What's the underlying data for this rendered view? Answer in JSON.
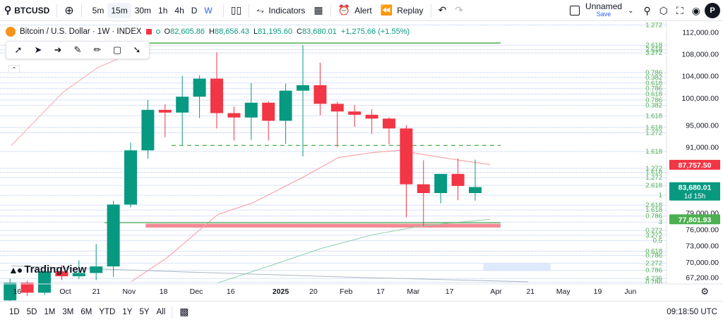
{
  "toolbar": {
    "symbol": "BTCUSD",
    "intervals": [
      "5m",
      "15m",
      "30m",
      "1h",
      "4h",
      "D",
      "W"
    ],
    "active_interval": "15m",
    "indicators_label": "Indicators",
    "alert_label": "Alert",
    "replay_label": "Replay",
    "layout_name": "Unnamed",
    "save_label": "Save",
    "profile_initial": "P"
  },
  "legend": {
    "title": "Bitcoin / U.S. Dollar · 1W · INDEX",
    "o_label": "O",
    "o_value": "82,605.86",
    "h_label": "H",
    "h_value": "88,656.43",
    "l_label": "L",
    "l_value": "81,195.60",
    "c_label": "C",
    "c_value": "83,680.01",
    "change": "+1,275.66 (+1.55%)"
  },
  "watermark": {
    "brand": "TradingView"
  },
  "bottom": {
    "ranges": [
      "1D",
      "5D",
      "1M",
      "3M",
      "6M",
      "YTD",
      "1Y",
      "5Y",
      "All"
    ],
    "clock": "09:18:50 UTC"
  },
  "colors": {
    "up": "#089981",
    "down": "#f23645",
    "grid": "#b2c5ef",
    "fib": "#4caf50",
    "ma_red": "#f7a6ad",
    "ma_green": "#8ccfa8"
  },
  "chart_data": {
    "type": "candlestick",
    "title": "",
    "ylim": [
      66000,
      114000
    ],
    "xlim_weeks": [
      0,
      52
    ],
    "price_ticks": [
      "112,000.00",
      "108,000.00",
      "104,000.00",
      "100,000.00",
      "95,000.00",
      "91,000.00",
      "79,000.00",
      "76,000.00",
      "73,000.00",
      "70,000.00",
      "67,200.00"
    ],
    "price_tick_values": [
      112000,
      108000,
      104000,
      100000,
      95000,
      91000,
      79000,
      76000,
      73000,
      70000,
      67200
    ],
    "time_labels": [
      {
        "label": "16",
        "w": 0.5
      },
      {
        "label": "Oct",
        "w": 3.3
      },
      {
        "label": "21",
        "w": 5.1
      },
      {
        "label": "Nov",
        "w": 7.0
      },
      {
        "label": "18",
        "w": 9.0
      },
      {
        "label": "Dec",
        "w": 10.9
      },
      {
        "label": "16",
        "w": 12.9
      },
      {
        "label": "2025",
        "w": 15.8
      },
      {
        "label": "20",
        "w": 17.7
      },
      {
        "label": "Feb",
        "w": 19.6
      },
      {
        "label": "17",
        "w": 21.6
      },
      {
        "label": "Mar",
        "w": 23.5
      },
      {
        "label": "17",
        "w": 25.6
      },
      {
        "label": "Apr",
        "w": 28.3
      },
      {
        "label": "21",
        "w": 30.3
      },
      {
        "label": "May",
        "w": 32.2
      },
      {
        "label": "19",
        "w": 34.2
      },
      {
        "label": "Jun",
        "w": 36.1
      }
    ],
    "candles": [
      {
        "o": 63000,
        "h": 67000,
        "l": 62000,
        "c": 66200
      },
      {
        "o": 66200,
        "h": 66600,
        "l": 63800,
        "c": 64400
      },
      {
        "o": 64400,
        "h": 68600,
        "l": 64000,
        "c": 68300
      },
      {
        "o": 68300,
        "h": 69400,
        "l": 66700,
        "c": 67400
      },
      {
        "o": 67400,
        "h": 70300,
        "l": 66900,
        "c": 68000
      },
      {
        "o": 68000,
        "h": 73300,
        "l": 66700,
        "c": 69200
      },
      {
        "o": 69200,
        "h": 81200,
        "l": 67300,
        "c": 80500
      },
      {
        "o": 80500,
        "h": 91800,
        "l": 80000,
        "c": 90400
      },
      {
        "o": 90400,
        "h": 99600,
        "l": 88900,
        "c": 97800
      },
      {
        "o": 97800,
        "h": 98800,
        "l": 92800,
        "c": 97300
      },
      {
        "o": 97300,
        "h": 104000,
        "l": 91400,
        "c": 100200
      },
      {
        "o": 100200,
        "h": 104100,
        "l": 96300,
        "c": 103500
      },
      {
        "o": 103500,
        "h": 108300,
        "l": 94400,
        "c": 97200
      },
      {
        "o": 97200,
        "h": 98400,
        "l": 92200,
        "c": 96400
      },
      {
        "o": 96400,
        "h": 102700,
        "l": 92300,
        "c": 99100
      },
      {
        "o": 99100,
        "h": 99400,
        "l": 92200,
        "c": 95800
      },
      {
        "o": 95800,
        "h": 102600,
        "l": 91600,
        "c": 101300
      },
      {
        "o": 101300,
        "h": 109600,
        "l": 89300,
        "c": 102300
      },
      {
        "o": 102300,
        "h": 106400,
        "l": 96800,
        "c": 98900
      },
      {
        "o": 98900,
        "h": 99300,
        "l": 91000,
        "c": 97500
      },
      {
        "o": 97500,
        "h": 98700,
        "l": 94700,
        "c": 96900
      },
      {
        "o": 96900,
        "h": 97900,
        "l": 93400,
        "c": 96200
      },
      {
        "o": 96200,
        "h": 96400,
        "l": 91500,
        "c": 94400
      },
      {
        "o": 94400,
        "h": 95000,
        "l": 78200,
        "c": 84200
      },
      {
        "o": 84200,
        "h": 88600,
        "l": 76600,
        "c": 82600
      },
      {
        "o": 82600,
        "h": 85900,
        "l": 80700,
        "c": 86100
      },
      {
        "o": 86100,
        "h": 88900,
        "l": 81300,
        "c": 83900
      },
      {
        "o": 82600,
        "h": 88700,
        "l": 81200,
        "c": 83700
      }
    ],
    "fib_levels": [
      {
        "label": "1.272",
        "price": 113300
      },
      {
        "label": "2.618",
        "price": 109600
      },
      {
        "label": "2.618",
        "price": 108800
      },
      {
        "label": "3.272",
        "price": 108200
      },
      {
        "label": "0.786",
        "price": 104600
      },
      {
        "label": "0.382",
        "price": 103700
      },
      {
        "label": "0.618",
        "price": 102700
      },
      {
        "label": "0.786",
        "price": 101700
      },
      {
        "label": "0.618",
        "price": 100700
      },
      {
        "label": "0.786",
        "price": 99600
      },
      {
        "label": "0.382",
        "price": 98600
      },
      {
        "label": "1.618",
        "price": 96700
      },
      {
        "label": "1.618",
        "price": 94600
      },
      {
        "label": "1.272",
        "price": 93600
      },
      {
        "label": "1.618",
        "price": 90200
      },
      {
        "label": "1.272",
        "price": 87100
      },
      {
        "label": "1.618",
        "price": 86400
      },
      {
        "label": "1.272",
        "price": 85400
      },
      {
        "label": "2.618",
        "price": 84000
      },
      {
        "label": "1",
        "price": 82200
      },
      {
        "label": "2.618",
        "price": 80400
      },
      {
        "label": "1.618",
        "price": 79500
      },
      {
        "label": "0.786",
        "price": 78400
      },
      {
        "label": "3",
        "price": 77300
      },
      {
        "label": "0.272",
        "price": 75800
      },
      {
        "label": "3.272",
        "price": 74900
      },
      {
        "label": "0.5",
        "price": 73900
      },
      {
        "label": "0.618",
        "price": 72000
      },
      {
        "label": "0.786",
        "price": 71200
      },
      {
        "label": "2.272",
        "price": 69800
      },
      {
        "label": "0.786",
        "price": 68500
      },
      {
        "label": "4.236",
        "price": 67000
      },
      {
        "label": "0.786",
        "price": 66300
      }
    ],
    "price_badges": [
      {
        "label": "87,757.50",
        "price": 87757.5,
        "color": "#f23645"
      },
      {
        "label": "83,680.01",
        "sublabel": "1d 15h",
        "price": 83680.01,
        "color": "#089981"
      },
      {
        "label": "77,801.93",
        "price": 77801.93,
        "color": "#4caf50"
      }
    ],
    "resistance_line": {
      "price": 110000,
      "from_w": 7.8,
      "to_w": 28.4
    },
    "support_line": {
      "price": 77200,
      "from_w": 5.4,
      "to_w": 28.4
    },
    "dashed_line": {
      "price": 91300,
      "from_w": 9.3,
      "to_w": 28.4
    },
    "support_zone": {
      "top": 77000,
      "bottom": 76300,
      "from_w": 7.8,
      "to_w": 28.4
    },
    "blue_zone": {
      "top": 69700,
      "bottom": 68400,
      "from_w": 27.4,
      "to_w": 31.3
    },
    "ma_red": [
      {
        "w": 0,
        "p": 91300
      },
      {
        "w": 3,
        "p": 101000
      },
      {
        "w": 5,
        "p": 105500
      },
      {
        "w": 7,
        "p": 108200
      }
    ],
    "ma_red2": [
      {
        "w": 7,
        "p": 66500
      },
      {
        "w": 9,
        "p": 70700
      },
      {
        "w": 12,
        "p": 78700
      },
      {
        "w": 14,
        "p": 80800
      },
      {
        "w": 17,
        "p": 85600
      },
      {
        "w": 19,
        "p": 89100
      },
      {
        "w": 21,
        "p": 90000
      },
      {
        "w": 22.5,
        "p": 90400
      },
      {
        "w": 24,
        "p": 89600
      },
      {
        "w": 26,
        "p": 88600
      },
      {
        "w": 27.8,
        "p": 87800
      }
    ],
    "ma_green": [
      {
        "w": 12,
        "p": 66200
      },
      {
        "w": 15,
        "p": 69300
      },
      {
        "w": 18,
        "p": 72500
      },
      {
        "w": 21,
        "p": 75000
      },
      {
        "w": 24,
        "p": 76700
      },
      {
        "w": 27.8,
        "p": 77800
      }
    ],
    "ma_grey": [
      {
        "w": 0,
        "p": 69300
      },
      {
        "w": 10,
        "p": 68200
      },
      {
        "w": 20,
        "p": 67200
      },
      {
        "w": 30,
        "p": 66400
      }
    ]
  }
}
